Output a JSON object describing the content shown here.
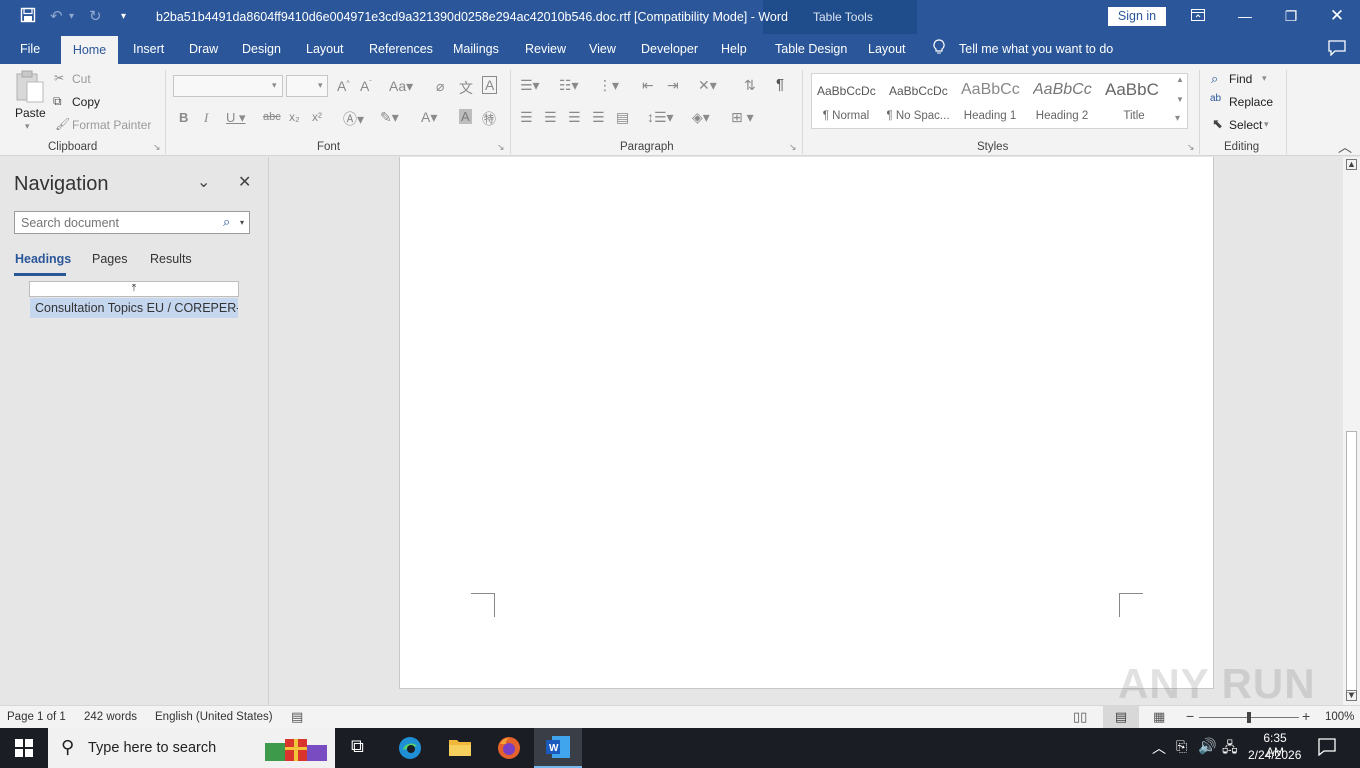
{
  "titlebar": {
    "document_title": "b2ba51b4491da8604ff9410d6e004971e3cd9a321390d0258e294ac42010b546.doc.rtf [Compatibility Mode]  -  Word",
    "table_tools": "Table Tools",
    "sign_in": "Sign in"
  },
  "tabs": {
    "file": "File",
    "home": "Home",
    "insert": "Insert",
    "draw": "Draw",
    "design": "Design",
    "layout": "Layout",
    "references": "References",
    "mailings": "Mailings",
    "review": "Review",
    "view": "View",
    "developer": "Developer",
    "help": "Help",
    "table_design": "Table Design",
    "table_layout": "Layout",
    "tell_me": "Tell me what you want to do"
  },
  "clipboard": {
    "paste": "Paste",
    "cut": "Cut",
    "copy": "Copy",
    "format_painter": "Format Painter",
    "label": "Clipboard"
  },
  "font": {
    "label": "Font"
  },
  "paragraph": {
    "label": "Paragraph"
  },
  "styles": {
    "label": "Styles",
    "items": [
      {
        "sample": "AaBbCcDc",
        "name": "¶ Normal"
      },
      {
        "sample": "AaBbCcDc",
        "name": "¶ No Spac..."
      },
      {
        "sample": "AaBbCc",
        "name": "Heading 1"
      },
      {
        "sample": "AaBbCc",
        "name": "Heading 2"
      },
      {
        "sample": "AaBbC",
        "name": "Title"
      }
    ]
  },
  "editing": {
    "find": "Find",
    "replace": "Replace",
    "select": "Select",
    "label": "Editing"
  },
  "navigation": {
    "title": "Navigation",
    "search_placeholder": "Search document",
    "tabs": {
      "headings": "Headings",
      "pages": "Pages",
      "results": "Results"
    },
    "heading_item": "Consultation Topics EU / COREPER-..."
  },
  "status": {
    "page": "Page 1 of 1",
    "words": "242 words",
    "language": "English (United States)",
    "zoom": "100%"
  },
  "taskbar": {
    "search": "Type here to search",
    "time": "6:35 AM",
    "date": "2/24/2026"
  },
  "watermark": "ANY RUN",
  "colors": {
    "word_blue": "#2b579a",
    "selected_heading": "#c5d6ef"
  }
}
